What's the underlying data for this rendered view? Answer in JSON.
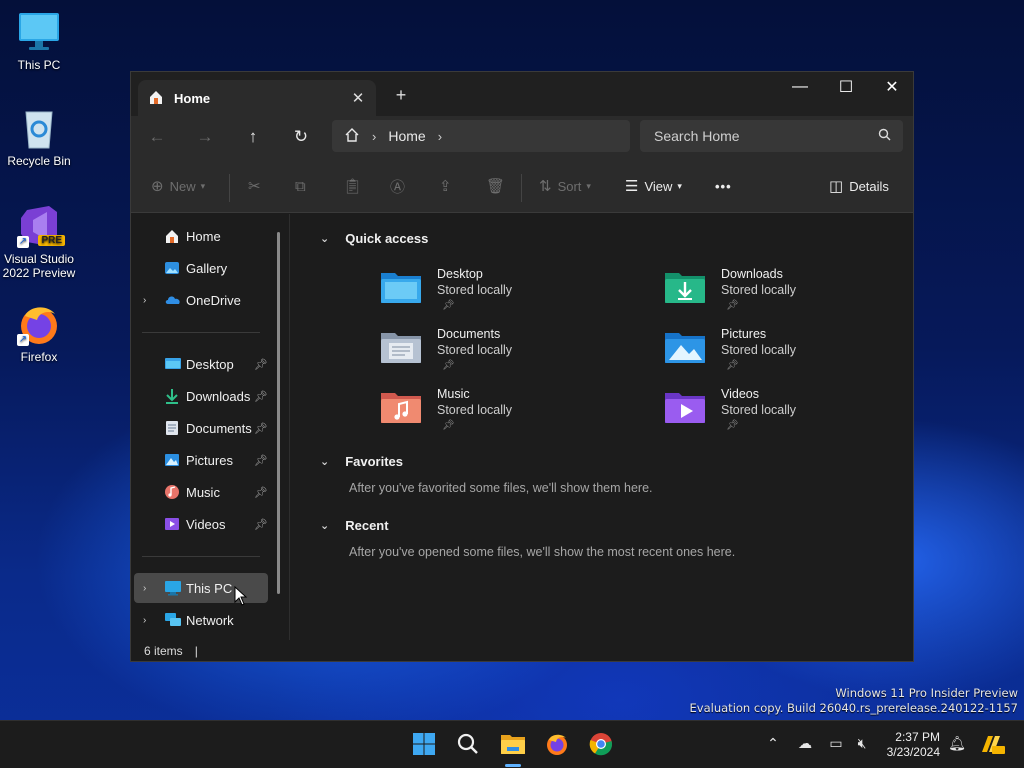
{
  "desktop": {
    "icons": [
      {
        "label": "This PC"
      },
      {
        "label": "Recycle Bin"
      },
      {
        "label": "Visual Studio\n2022 Preview",
        "badge": "PRE"
      },
      {
        "label": "Firefox"
      }
    ],
    "watermark": {
      "line1": "Windows 11 Pro Insider Preview",
      "line2": "Evaluation copy. Build 26040.rs_prerelease.240122-1157"
    }
  },
  "explorer": {
    "tab": {
      "label": "Home",
      "icon": "home-icon"
    },
    "address": {
      "breadcrumb": "Home"
    },
    "search": {
      "placeholder": "Search Home"
    },
    "toolbar": {
      "new_label": "New",
      "sort_label": "Sort",
      "view_label": "View",
      "more_label": "•••",
      "details_label": "Details"
    },
    "sidebar": {
      "top": [
        {
          "label": "Home",
          "icon": "home-icon"
        },
        {
          "label": "Gallery",
          "icon": "gallery-icon"
        },
        {
          "label": "OneDrive",
          "icon": "cloud-icon"
        }
      ],
      "pinned": [
        {
          "label": "Desktop",
          "icon": "desktop-folder-icon"
        },
        {
          "label": "Downloads",
          "icon": "download-icon"
        },
        {
          "label": "Documents",
          "icon": "documents-icon"
        },
        {
          "label": "Pictures",
          "icon": "pictures-icon"
        },
        {
          "label": "Music",
          "icon": "music-icon"
        },
        {
          "label": "Videos",
          "icon": "videos-icon"
        }
      ],
      "bottom": [
        {
          "label": "This PC",
          "icon": "pc-icon"
        },
        {
          "label": "Network",
          "icon": "network-icon"
        }
      ]
    },
    "quick_access": {
      "title": "Quick access",
      "items": [
        {
          "name": "Desktop",
          "status": "Stored locally"
        },
        {
          "name": "Downloads",
          "status": "Stored locally"
        },
        {
          "name": "Documents",
          "status": "Stored locally"
        },
        {
          "name": "Pictures",
          "status": "Stored locally"
        },
        {
          "name": "Music",
          "status": "Stored locally"
        },
        {
          "name": "Videos",
          "status": "Stored locally"
        }
      ]
    },
    "favorites": {
      "title": "Favorites",
      "message": "After you've favorited some files, we'll show them here."
    },
    "recent": {
      "title": "Recent",
      "message": "After you've opened some files, we'll show the most recent ones here."
    },
    "status": {
      "items": "6 items"
    }
  },
  "taskbar": {
    "clock": {
      "time": "2:37 PM",
      "date": "3/23/2024"
    }
  },
  "colors": {
    "accent": "#5fb2ff",
    "window_bg": "#1c1c1c",
    "toolbar_bg": "#2b2b2b"
  }
}
